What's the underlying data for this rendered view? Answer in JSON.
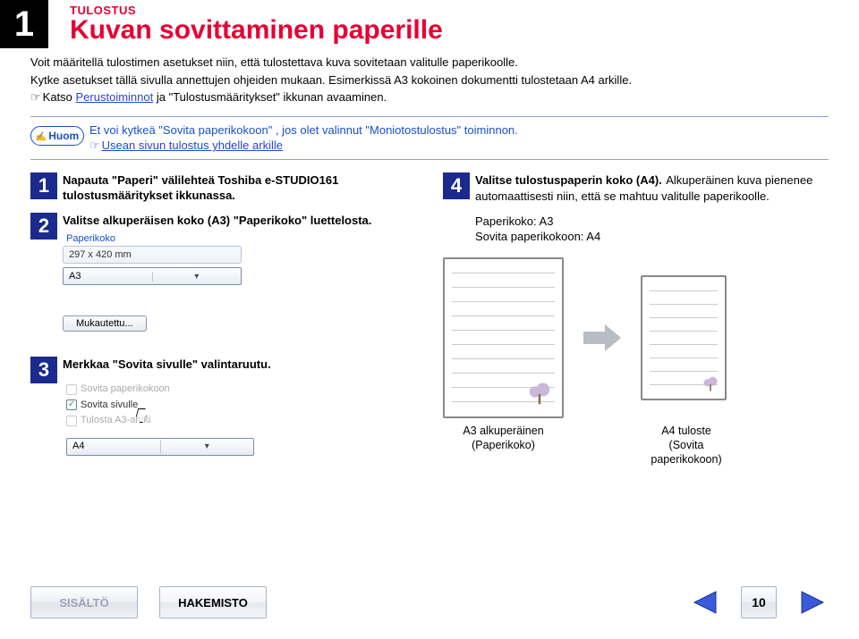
{
  "chapter_number": "1",
  "section_label": "TULOSTUS",
  "section_title": "Kuvan sovittaminen paperille",
  "intro": {
    "p1": "Voit määritellä tulostimen asetukset niin, että tulostettava kuva sovitetaan valitulle paperikoolle.",
    "p2": "Kytke asetukset tällä sivulla annettujen ohjeiden mukaan. Esimerkissä A3 kokoinen dokumentti tulostetaan A4 arkille.",
    "p3_prefix": "Katso ",
    "p3_link": "Perustoiminnot",
    "p3_suffix": " ja \"Tulostusmääritykset\" ikkunan avaaminen."
  },
  "note": {
    "badge": "Huom",
    "line1": "Et voi kytkeä \"Sovita paperikokoon\" , jos olet valinnut \"Moniotostulostus\" toiminnon.",
    "link": "Usean sivun tulostus yhdelle arkille"
  },
  "steps": {
    "s1_num": "1",
    "s1_text": "Napauta \"Paperi\" välilehteä Toshiba e-STUDIO161 tulostusmääritykset ikkunassa.",
    "s2_num": "2",
    "s2_text": "Valitse alkuperäisen koko (A3) \"Paperikoko\" luettelosta.",
    "s3_num": "3",
    "s3_text": "Merkkaa \"Sovita sivulle\" valintaruutu.",
    "s4_num": "4",
    "s4_text": "Valitse tulostuspaperin koko (A4).",
    "s4_extra": "Alkuperäinen kuva pienenee automaattisesti niin, että se mahtuu valitulle paperikoolle.",
    "s4_info1": "Paperikoko: A3",
    "s4_info2": "Sovita paperikokoon: A4"
  },
  "panel1": {
    "group_label": "Paperikoko",
    "size_text": "297 x 420 mm",
    "combo_value": "A3",
    "button": "Mukautettu..."
  },
  "panel3": {
    "opt1": "Sovita paperikokoon",
    "opt2": "Sovita sivulle",
    "opt3": "Tulosta A3-arkki",
    "combo_value": "A4"
  },
  "diagram": {
    "cap_a3_l1": "A3 alkuperäinen",
    "cap_a3_l2": "(Paperikoko)",
    "cap_a4_l1": "A4 tuloste",
    "cap_a4_l2": "(Sovita",
    "cap_a4_l3": "paperikokoon)"
  },
  "footer": {
    "contents": "SISÄLTÖ",
    "index": "HAKEMISTO",
    "page": "10"
  },
  "hand_glyph": "☞"
}
